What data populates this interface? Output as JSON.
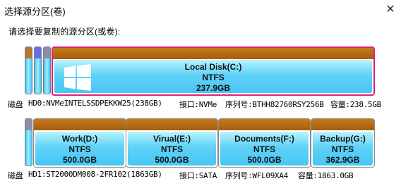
{
  "window": {
    "title": "选择源分区(卷)",
    "close_glyph": "✕"
  },
  "prompt": "请选择要复制的源分区(或卷):",
  "disks": [
    {
      "info": {
        "disk_label": "磁盘",
        "disk": "HD0:NVMeINTELSSDPEKKW25(238GB)",
        "iface": "接口:NVMe",
        "serial": "序列号:BTHH82760RSY256B",
        "capacity": "容量:238.5GB"
      },
      "small_partitions": [
        {
          "cap_color": "#b4782c"
        },
        {
          "cap_color": "#6a6af0"
        },
        {
          "cap_color": "#8e8ea8"
        }
      ],
      "partitions": [
        {
          "name": "Local Disk(C:)",
          "fs": "NTFS",
          "size": "237.9GB",
          "selected": true,
          "has_windows_logo": true
        }
      ]
    },
    {
      "info": {
        "disk_label": "磁盘",
        "disk": "HD1:ST2000DM008-2FR102(1863GB)",
        "iface": "接口:SATA",
        "serial": "序列号:WFL09XA4",
        "capacity": "容量:1863.0GB"
      },
      "small_partitions": [
        {
          "cap_color": "#8e8ea8"
        }
      ],
      "partitions": [
        {
          "name": "Work(D:)",
          "fs": "NTFS",
          "size": "500.0GB",
          "selected": false
        },
        {
          "name": "Virual(E:)",
          "fs": "NTFS",
          "size": "500.0GB",
          "selected": false
        },
        {
          "name": "Documents(F:)",
          "fs": "NTFS",
          "size": "500.0GB",
          "selected": false
        },
        {
          "name": "Backup(G:)",
          "fs": "NTFS",
          "size": "362.9GB",
          "selected": false
        }
      ]
    }
  ]
}
